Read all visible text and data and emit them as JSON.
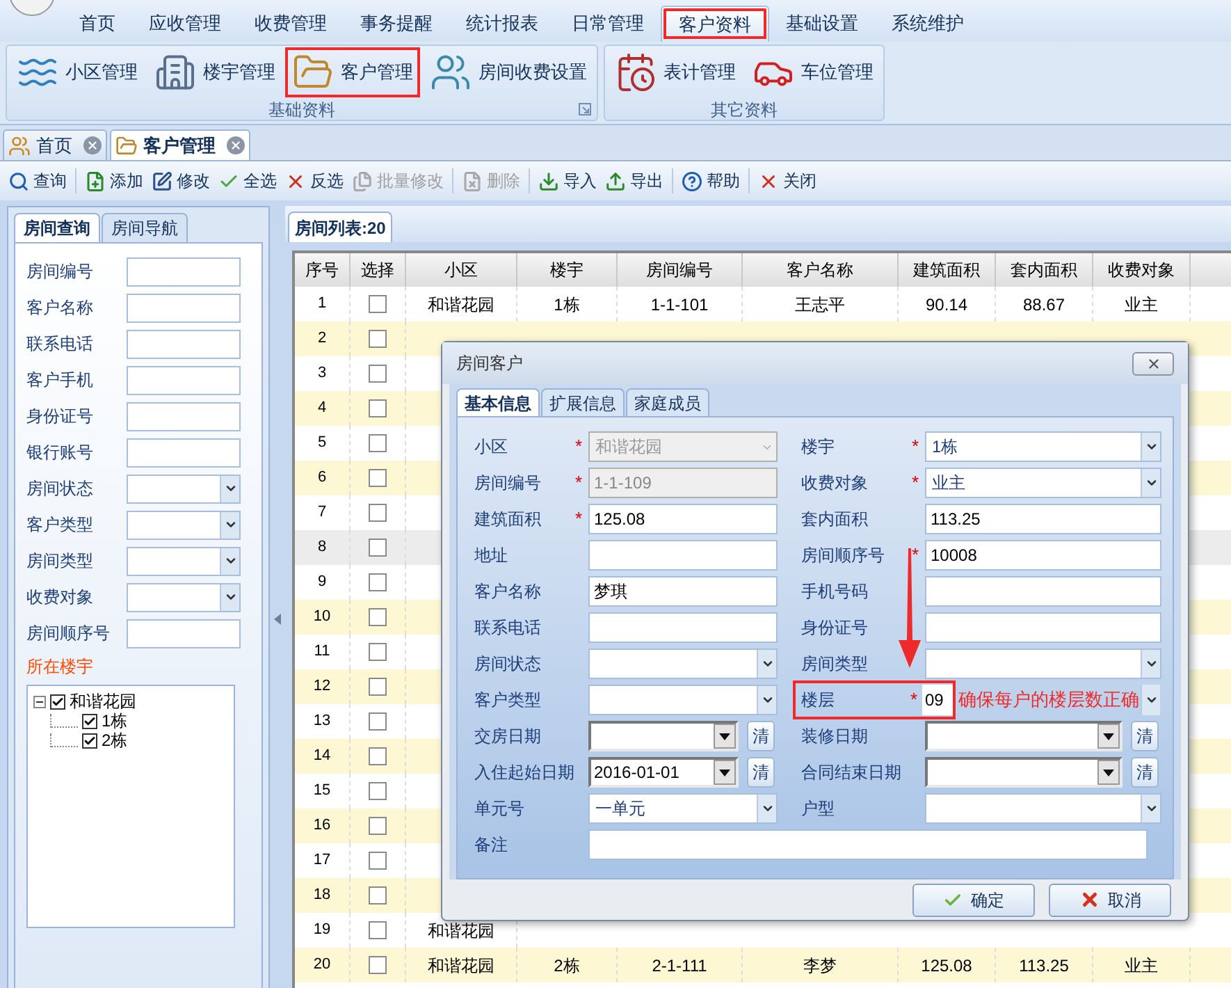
{
  "menu_tabs": [
    {
      "label": "首页",
      "selected": false,
      "annotated": false
    },
    {
      "label": "应收管理",
      "selected": false,
      "annotated": false
    },
    {
      "label": "收费管理",
      "selected": false,
      "annotated": false
    },
    {
      "label": "事务提醒",
      "selected": false,
      "annotated": false
    },
    {
      "label": "统计报表",
      "selected": false,
      "annotated": false
    },
    {
      "label": "日常管理",
      "selected": false,
      "annotated": false
    },
    {
      "label": "客户资料",
      "selected": true,
      "annotated": true
    },
    {
      "label": "基础设置",
      "selected": false,
      "annotated": false
    },
    {
      "label": "系统维护",
      "selected": false,
      "annotated": false
    }
  ],
  "ribbon_groups": [
    {
      "title": "基础资料",
      "items": [
        {
          "label": "小区管理",
          "annotated": false
        },
        {
          "label": "楼宇管理",
          "annotated": false
        },
        {
          "label": "客户管理",
          "annotated": true
        },
        {
          "label": "房间收费设置",
          "annotated": false
        }
      ]
    },
    {
      "title": "其它资料",
      "items": [
        {
          "label": "表计管理",
          "annotated": false
        },
        {
          "label": "车位管理",
          "annotated": false
        }
      ]
    }
  ],
  "doc_tabs": [
    {
      "label": "首页",
      "selected": false
    },
    {
      "label": "客户管理",
      "selected": true
    }
  ],
  "toolbar": [
    {
      "label": "查询",
      "disabled": false
    },
    {
      "label": "添加",
      "disabled": false
    },
    {
      "label": "修改",
      "disabled": false
    },
    {
      "label": "全选",
      "disabled": false
    },
    {
      "label": "反选",
      "disabled": false
    },
    {
      "label": "批量修改",
      "disabled": true
    },
    {
      "label": "删除",
      "disabled": true
    },
    {
      "label": "导入",
      "disabled": false
    },
    {
      "label": "导出",
      "disabled": false
    },
    {
      "label": "帮助",
      "disabled": false
    },
    {
      "label": "关闭",
      "disabled": false
    }
  ],
  "left_panel": {
    "tabs": [
      {
        "label": "房间查询",
        "selected": true
      },
      {
        "label": "房间导航",
        "selected": false
      }
    ],
    "fields": [
      {
        "label": "房间编号",
        "kind": "text"
      },
      {
        "label": "客户名称",
        "kind": "text"
      },
      {
        "label": "联系电话",
        "kind": "text"
      },
      {
        "label": "客户手机",
        "kind": "text"
      },
      {
        "label": "身份证号",
        "kind": "text"
      },
      {
        "label": "银行账号",
        "kind": "text"
      },
      {
        "label": "房间状态",
        "kind": "select"
      },
      {
        "label": "客户类型",
        "kind": "select"
      },
      {
        "label": "房间类型",
        "kind": "select"
      },
      {
        "label": "收费对象",
        "kind": "select"
      },
      {
        "label": "房间顺序号",
        "kind": "text"
      }
    ],
    "tree_title": "所在楼宇",
    "tree": [
      {
        "label": "和谐花园",
        "checked": true,
        "expanded": true,
        "children": [
          {
            "label": "1栋",
            "checked": true
          },
          {
            "label": "2栋",
            "checked": true
          }
        ]
      }
    ]
  },
  "room_list": {
    "title": "房间列表:20",
    "columns": [
      "序号",
      "选择",
      "小区",
      "楼宇",
      "房间编号",
      "客户名称",
      "建筑面积",
      "套内面积",
      "收费对象"
    ],
    "rows": [
      {
        "checked": false,
        "selected": false,
        "cells": [
          "1",
          "",
          "和谐花园",
          "1栋",
          "1-1-101",
          "王志平",
          "90.14",
          "88.67",
          "业主"
        ]
      },
      {
        "checked": false,
        "selected": false,
        "cells": [
          "2",
          ""
        ]
      },
      {
        "checked": false,
        "selected": false,
        "cells": [
          "3",
          ""
        ]
      },
      {
        "checked": false,
        "selected": false,
        "cells": [
          "4",
          ""
        ]
      },
      {
        "checked": false,
        "selected": false,
        "cells": [
          "5",
          ""
        ]
      },
      {
        "checked": false,
        "selected": false,
        "cells": [
          "6",
          ""
        ]
      },
      {
        "checked": false,
        "selected": false,
        "cells": [
          "7",
          ""
        ]
      },
      {
        "checked": false,
        "selected": true,
        "cells": [
          "8",
          ""
        ]
      },
      {
        "checked": false,
        "selected": false,
        "cells": [
          "9",
          ""
        ]
      },
      {
        "checked": false,
        "selected": false,
        "cells": [
          "10",
          ""
        ]
      },
      {
        "checked": false,
        "selected": false,
        "cells": [
          "11",
          ""
        ]
      },
      {
        "checked": false,
        "selected": false,
        "cells": [
          "12",
          ""
        ]
      },
      {
        "checked": false,
        "selected": false,
        "cells": [
          "13",
          ""
        ]
      },
      {
        "checked": false,
        "selected": false,
        "cells": [
          "14",
          ""
        ]
      },
      {
        "checked": false,
        "selected": false,
        "cells": [
          "15",
          ""
        ]
      },
      {
        "checked": false,
        "selected": false,
        "cells": [
          "16",
          ""
        ]
      },
      {
        "checked": false,
        "selected": false,
        "cells": [
          "17",
          ""
        ]
      },
      {
        "checked": false,
        "selected": false,
        "cells": [
          "18",
          ""
        ]
      },
      {
        "checked": false,
        "selected": false,
        "cells": [
          "19",
          "",
          "和谐花园"
        ]
      },
      {
        "checked": false,
        "selected": false,
        "cells": [
          "20",
          "",
          "和谐花园",
          "2栋",
          "2-1-111",
          "李梦",
          "125.08",
          "113.25",
          "业主"
        ]
      }
    ]
  },
  "dialog": {
    "title": "房间客户",
    "tabs": [
      {
        "label": "基本信息",
        "selected": true
      },
      {
        "label": "扩展信息",
        "selected": false
      },
      {
        "label": "家庭成员",
        "selected": false
      }
    ],
    "fields": [
      {
        "label": "小区",
        "required_mark": "*",
        "kind": "select",
        "value": "和谐花园",
        "disabled": true
      },
      {
        "label": "楼宇",
        "required_mark": "*",
        "kind": "select",
        "value": "1栋",
        "disabled": false
      },
      {
        "label": "房间编号",
        "required_mark": "*",
        "kind": "text",
        "value": "1-1-109",
        "disabled": true
      },
      {
        "label": "收费对象",
        "required_mark": "*",
        "kind": "select",
        "value": "业主",
        "disabled": false
      },
      {
        "label": "建筑面积",
        "required_mark": "*",
        "kind": "text",
        "value": "125.08",
        "disabled": false
      },
      {
        "label": "套内面积",
        "kind": "text",
        "value": "113.25",
        "disabled": false
      },
      {
        "label": "地址",
        "kind": "text",
        "disabled": false
      },
      {
        "label": "房间顺序号",
        "required_mark": "*",
        "kind": "text",
        "value": "10008",
        "disabled": false
      },
      {
        "label": "客户名称",
        "kind": "text",
        "value": "梦琪",
        "disabled": false
      },
      {
        "label": "手机号码",
        "kind": "text",
        "disabled": false
      },
      {
        "label": "联系电话",
        "kind": "text",
        "disabled": false
      },
      {
        "label": "身份证号",
        "kind": "text",
        "disabled": false
      },
      {
        "label": "房间状态",
        "kind": "select",
        "disabled": false
      },
      {
        "label": "房间类型",
        "kind": "select",
        "disabled": false
      },
      {
        "label": "客户类型",
        "kind": "select",
        "disabled": false
      },
      {
        "label": "楼层",
        "required_mark": "*",
        "kind": "select",
        "value": "09",
        "disabled": false,
        "annotation": "确保每户的楼层数正确"
      },
      {
        "label": "交房日期",
        "kind": "date",
        "disabled": false,
        "clear": "清"
      },
      {
        "label": "装修日期",
        "kind": "date",
        "disabled": false,
        "clear": "清"
      },
      {
        "label": "入住起始日期",
        "kind": "date",
        "value": "2016-01-01",
        "disabled": false,
        "clear": "清"
      },
      {
        "label": "合同结束日期",
        "kind": "date",
        "disabled": false,
        "clear": "清"
      },
      {
        "label": "单元号",
        "kind": "select",
        "value": "一单元",
        "disabled": false
      },
      {
        "label": "户型",
        "kind": "select",
        "disabled": false
      },
      {
        "label": "备注",
        "kind": "wide"
      }
    ],
    "buttons": [
      {
        "label": "确定",
        "kind": "ok"
      },
      {
        "label": "取消",
        "kind": "cancel"
      }
    ]
  }
}
